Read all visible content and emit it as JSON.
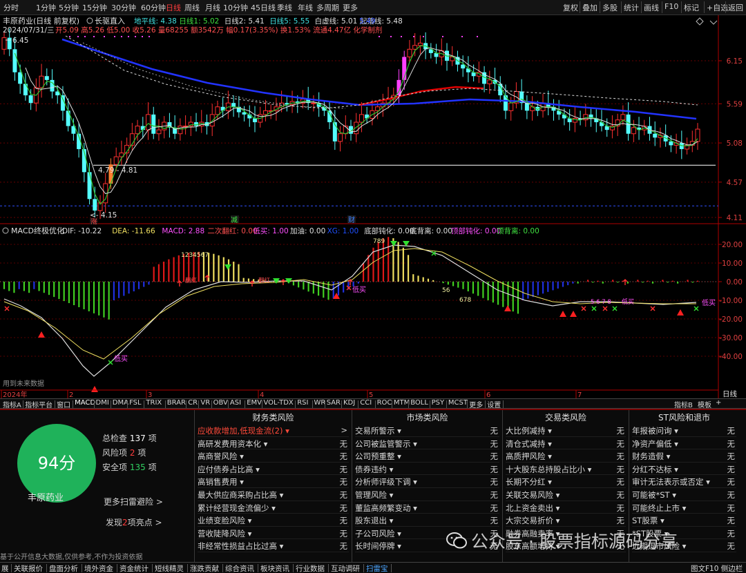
{
  "toolbar": {
    "periods": [
      "分时",
      "1分钟",
      "5分钟",
      "15分钟",
      "30分钟",
      "60分钟",
      "日线",
      "周线",
      "月线",
      "10分钟",
      "45日线",
      "季线",
      "年线",
      "多周期",
      "更多"
    ],
    "selected_period": "日线",
    "right_buttons": [
      "复权",
      "叠加",
      "多股",
      "统计",
      "画线",
      "F10",
      "标记",
      "+自选",
      "返回"
    ]
  },
  "stock_header": {
    "name_line": "丰原药业(日线 前复权)",
    "indicator_name": "长驱直入",
    "lines": [
      "地平线: 4.38",
      "日线1: 5.02",
      "日线2: 5.41",
      "日线5: 5.55",
      "白虚线: 5.01",
      "起落线: 5.48"
    ],
    "date": "2024/07/31/三",
    "quote": "开5.09 高5.26 低5.00 收5.26 量68255 额3542万 幅0.17(3.35%) 换1.53% 流通4.47亿 化学制剂",
    "extra": "5.49"
  },
  "main_chart": {
    "y_ticks": [
      "6.15",
      "5.59",
      "5.08",
      "4.57",
      "4.11"
    ],
    "y_values": [
      6.15,
      5.59,
      5.08,
      4.57,
      4.11
    ],
    "high_label": "6.45",
    "low_label": "4.15",
    "level_label": "4.79 - 4.81",
    "marker_labels": [
      "涨",
      "减",
      "财"
    ]
  },
  "macd": {
    "title": "MACD终极优化",
    "values": [
      "DIF: -10.22",
      "DEA: -11.66",
      "MACD: 2.88",
      "二次翻红: 0.00",
      "低买: 1.00",
      "加油: 0.00",
      "XG: 1.00",
      "底部钝化: 0.00",
      "底背离: 0.00",
      "顶部钝化: 0.00",
      "顶背离: 0.00"
    ],
    "y_ticks": [
      "20.00",
      "10.00",
      "0.00",
      "-10.00",
      "-20.00",
      "-30.00",
      "-40.00"
    ],
    "annotations": [
      "低买",
      "低买",
      "低买",
      "低买",
      "翻红",
      "翻红",
      "1234567",
      "789",
      "56",
      "678",
      "5 6 7 8"
    ],
    "footnote": "用到未来数据"
  },
  "months": [
    "2024年",
    "2",
    "3",
    "4",
    "5",
    "6",
    "7"
  ],
  "period_label": "日线",
  "indicator_tabs": [
    "指标A",
    "指标平台",
    "窗口",
    "MACD",
    "DMI",
    "DMA",
    "FSL",
    "TRIX",
    "BRAR",
    "CR",
    "VR",
    "OBV",
    "ASI",
    "EMV",
    "VOL-TDX",
    "RSI",
    "WR",
    "SAR",
    "KDJ",
    "CCI",
    "ROC",
    "MTM",
    "BOLL",
    "PSY",
    "MCST",
    "更多",
    "设置"
  ],
  "indicator_right": [
    "指标B",
    "模板",
    "+"
  ],
  "scan": {
    "score": "94分",
    "company": "丰原药业",
    "total_label": "总检查",
    "total": "137",
    "risk_label": "风险项",
    "risk": "2",
    "safe_label": "安全项",
    "safe": "135",
    "unit": "项",
    "more": "更多扫雷避险 >",
    "find_prefix": "发现",
    "find_count": "2",
    "find_suffix": "项亮点 >",
    "disclaimer": "基于公开信息大数据,仅供参考,不作为投资依据"
  },
  "risk_columns": [
    {
      "title": "财务类风险",
      "rows": [
        {
          "name": "应收款增加,低现金流(2)",
          "value": ">",
          "hot": true
        },
        {
          "name": "高研发费用资本化",
          "value": "无"
        },
        {
          "name": "高商誉风险",
          "value": "无"
        },
        {
          "name": "应付债券占比高",
          "value": "无"
        },
        {
          "name": "高销售费用",
          "value": "无"
        },
        {
          "name": "最大供应商采购占比高",
          "value": "无"
        },
        {
          "name": "累计经营现金流偏少",
          "value": "无"
        },
        {
          "name": "业绩变脸风险",
          "value": "无"
        },
        {
          "name": "营收陡降风险",
          "value": "无"
        },
        {
          "name": "非经常性损益占比过高",
          "value": "无"
        }
      ]
    },
    {
      "title": "市场类风险",
      "rows": [
        {
          "name": "交易所警示",
          "value": "无"
        },
        {
          "name": "公司被监管警示",
          "value": "无"
        },
        {
          "name": "公司预重整",
          "value": "无"
        },
        {
          "name": "债券违约",
          "value": "无"
        },
        {
          "name": "分析师评级下调",
          "value": "无"
        },
        {
          "name": "管理风险",
          "value": "无"
        },
        {
          "name": "董监高频繁变动",
          "value": "无"
        },
        {
          "name": "股东退出",
          "value": "无"
        },
        {
          "name": "子公司风险",
          "value": "无"
        },
        {
          "name": "长时间停牌",
          "value": "无"
        }
      ]
    },
    {
      "title": "交易类风险",
      "rows": [
        {
          "name": "大比例减持",
          "value": "无"
        },
        {
          "name": "清仓式减持",
          "value": "无"
        },
        {
          "name": "高质押风险",
          "value": "无"
        },
        {
          "name": "十大股东总持股占比小",
          "value": "无"
        },
        {
          "name": "长期不分红",
          "value": "无"
        },
        {
          "name": "关联交易风险",
          "value": "无"
        },
        {
          "name": "北上资金卖出",
          "value": "无"
        },
        {
          "name": "大宗交易折价",
          "value": "无"
        },
        {
          "name": "融券高融卖率",
          "value": "无"
        },
        {
          "name": "股东高额增持",
          "value": "无"
        }
      ]
    },
    {
      "title": "ST风险和退市",
      "rows": [
        {
          "name": "年报被问询",
          "value": "无"
        },
        {
          "name": "净资产偏低",
          "value": "无"
        },
        {
          "name": "财务造假",
          "value": "无"
        },
        {
          "name": "分红不达标",
          "value": "无"
        },
        {
          "name": "审计无法表示或否定",
          "value": "无"
        },
        {
          "name": "可能被*ST",
          "value": "无"
        },
        {
          "name": "可能终止上市",
          "value": "无"
        },
        {
          "name": "ST股票",
          "value": "无"
        },
        {
          "name": "*ST股票",
          "value": "无"
        },
        {
          "name": "近期退市风险",
          "value": "无"
        }
      ]
    }
  ],
  "bottom_tabs": [
    "展",
    "关联报价",
    "盘面分析",
    "境外资金",
    "资金统计",
    "短线精灵",
    "涨跌贡献",
    "综合资讯",
    "板块资讯",
    "行业数据",
    "互动调研",
    "扫雷宝"
  ],
  "bottom_selected": "扫雷宝",
  "bottom_right": "图文F10 侧边栏",
  "watermark": "公众号 · 股票指标源码分享",
  "colors": {
    "up": "#ff3030",
    "down": "#54ffff",
    "ma_blue": "#2020ff",
    "ma_red": "#e00000",
    "macd_red": "#e01818",
    "macd_yellow": "#f0e060",
    "macd_green": "#40d020",
    "macd_blue": "#2030e0",
    "score": "#1fb25a"
  }
}
